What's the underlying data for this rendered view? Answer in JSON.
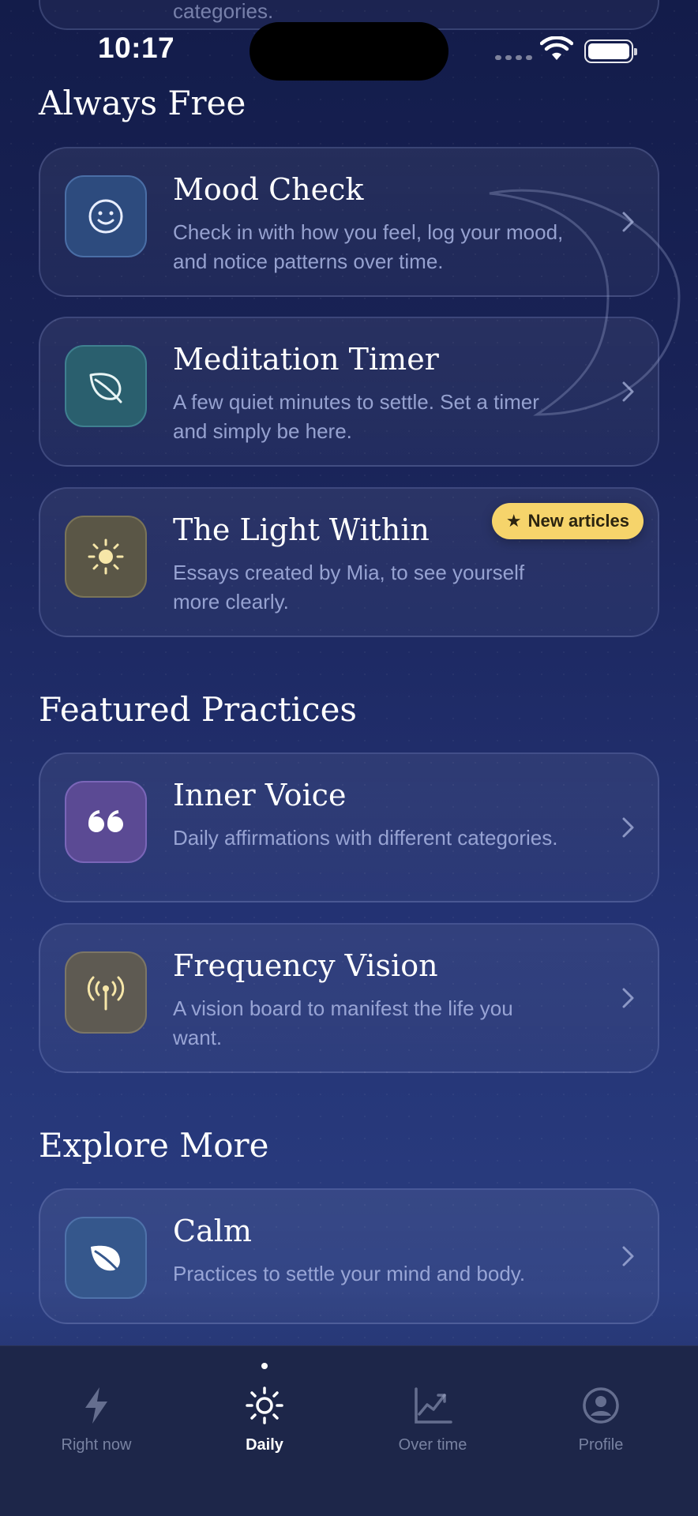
{
  "status_bar": {
    "time": "10:17"
  },
  "top_partial_text": "categories.",
  "sections": {
    "always_free": "Always Free",
    "featured": "Featured Practices",
    "explore": "Explore More"
  },
  "cards": {
    "mood_check": {
      "title": "Mood Check",
      "desc": "Check in with how you feel, log your mood, and notice patterns over time."
    },
    "meditation_timer": {
      "title": "Meditation Timer",
      "desc": "A few quiet minutes to settle. Set a timer and simply be here."
    },
    "light_within": {
      "title": "The Light Within",
      "desc": "Essays created by Mia, to see yourself more clearly.",
      "badge": "New articles"
    },
    "inner_voice": {
      "title": "Inner Voice",
      "desc": "Daily affirmations with different categories."
    },
    "frequency_vision": {
      "title": "Frequency Vision",
      "desc": "A vision board to manifest the life you want."
    },
    "calm": {
      "title": "Calm",
      "desc": "Practices to settle your mind and body."
    }
  },
  "tabs": [
    {
      "label": "Right now",
      "icon": "bolt-icon",
      "active": false
    },
    {
      "label": "Daily",
      "icon": "sun-icon",
      "active": true
    },
    {
      "label": "Over time",
      "icon": "chart-icon",
      "active": false
    },
    {
      "label": "Profile",
      "icon": "profile-icon",
      "active": false
    }
  ],
  "colors": {
    "badge": "#f6d46b",
    "accent_blue": "#3a5a9c",
    "accent_teal": "#2f6a7a",
    "accent_purple": "#5a4a9c",
    "accent_gold": "#6a6250"
  }
}
